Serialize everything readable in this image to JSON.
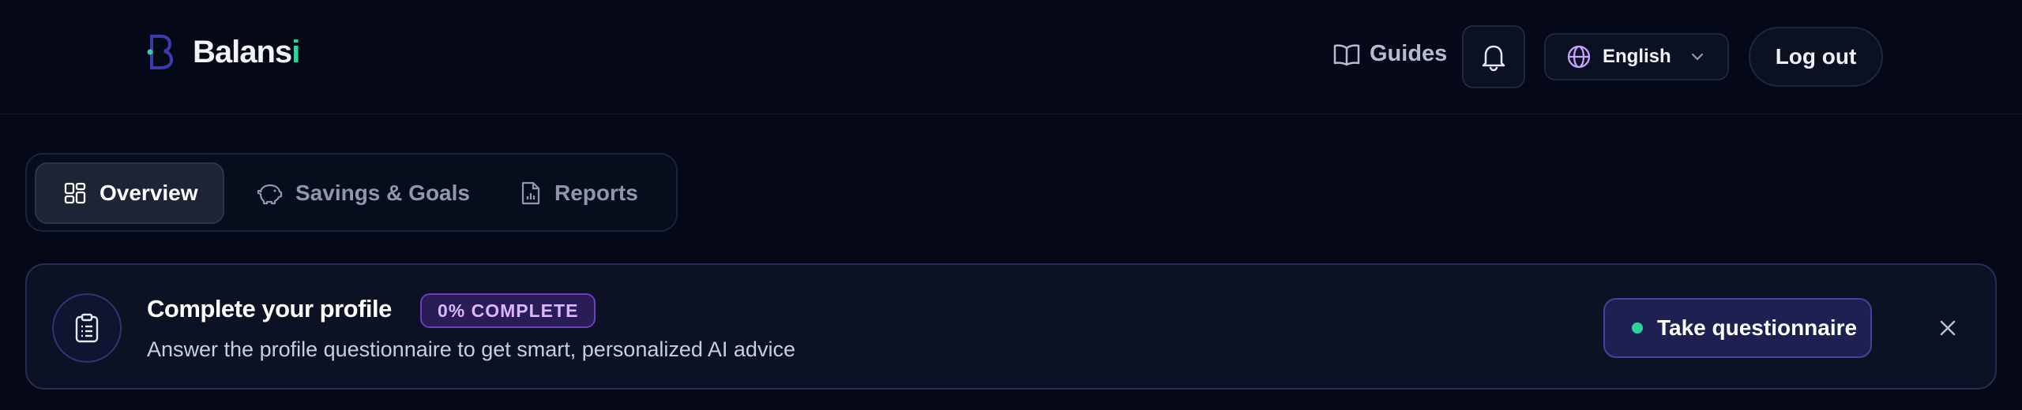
{
  "header": {
    "logo_text_first": "B",
    "logo_text_mid": "alans",
    "logo_text_accent": "i",
    "guides_label": "Guides",
    "language_label": "English",
    "logout_label": "Log out"
  },
  "tabs": [
    {
      "label": "Overview",
      "icon": "dashboard-icon",
      "active": true
    },
    {
      "label": "Savings & Goals",
      "icon": "piggy-bank-icon",
      "active": false
    },
    {
      "label": "Reports",
      "icon": "report-file-icon",
      "active": false
    }
  ],
  "banner": {
    "title": "Complete your profile",
    "badge": "0% COMPLETE",
    "progress_percent": 0,
    "subtitle": "Answer the profile questionnaire to get smart, personalized AI advice",
    "cta_label": "Take questionnaire",
    "icon": "clipboard-icon"
  },
  "colors": {
    "background": "#050817",
    "accent_green": "#2dd4a0",
    "accent_purple": "#6a3fc0",
    "badge_text": "#d9b6ff"
  }
}
